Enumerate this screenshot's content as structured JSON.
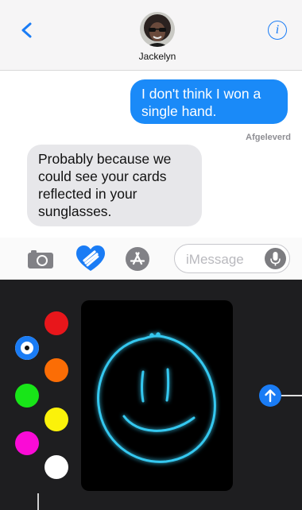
{
  "header": {
    "contact_name": "Jackelyn",
    "back_icon": "chevron-left-icon",
    "info_icon": "info-icon",
    "info_glyph": "i"
  },
  "thread": {
    "messages": [
      {
        "direction": "sent",
        "text": "I don't think I won a single hand."
      },
      {
        "direction": "received",
        "text": "Probably because we could see your cards reflected in your sunglasses."
      }
    ],
    "status": "Afgeleverd"
  },
  "input_bar": {
    "placeholder": "iMessage",
    "icons": [
      "camera-icon",
      "digital-touch-icon",
      "app-store-icon",
      "microphone-icon"
    ]
  },
  "digital_touch": {
    "colors": [
      {
        "name": "blue",
        "hex": "#1a7cf5",
        "selected": true
      },
      {
        "name": "red",
        "hex": "#e8161b",
        "selected": false
      },
      {
        "name": "orange",
        "hex": "#fb6d05",
        "selected": false
      },
      {
        "name": "green",
        "hex": "#18e518",
        "selected": false
      },
      {
        "name": "yellow",
        "hex": "#fbf20a",
        "selected": false
      },
      {
        "name": "magenta",
        "hex": "#fa0bd6",
        "selected": false
      },
      {
        "name": "white",
        "hex": "#ffffff",
        "selected": false
      }
    ],
    "drawing": "smiley-face",
    "stroke_color": "#34c8f0",
    "send_icon": "arrow-up-icon"
  },
  "colors": {
    "accent": "#1a7cf5",
    "sent_bubble": "#1a8af8",
    "received_bubble": "#e7e7ea",
    "panel_bg": "#1e1e20"
  }
}
